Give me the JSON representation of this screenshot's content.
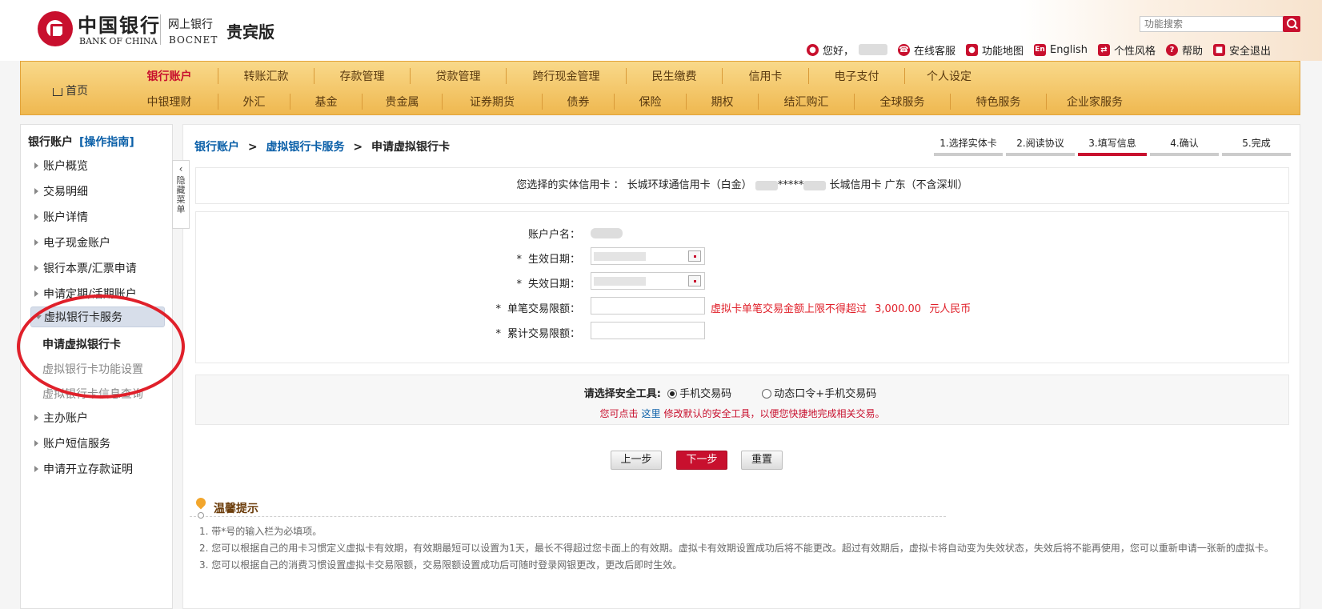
{
  "header": {
    "logo_cn": "中国银行",
    "logo_en": "BANK OF CHINA",
    "bank_cn": "网上银行",
    "bank_en": "BOCNET",
    "edition": "贵宾版",
    "search_placeholder": "功能搜索",
    "greeting": "您好，",
    "links": [
      "在线客服",
      "功能地图",
      "English",
      "个性风格",
      "帮助",
      "安全退出"
    ],
    "link_icons": [
      "user-icon",
      "headset-icon",
      "map-pin-icon",
      "en-icon",
      "swap-icon",
      "help-icon",
      "lock-icon"
    ]
  },
  "nav": {
    "home": "首页",
    "row1": [
      "银行账户",
      "转账汇款",
      "存款管理",
      "贷款管理",
      "跨行现金管理",
      "民生缴费",
      "信用卡",
      "电子支付",
      "个人设定"
    ],
    "row2": [
      "中银理财",
      "外汇",
      "基金",
      "贵金属",
      "证券期货",
      "债券",
      "保险",
      "期权",
      "结汇购汇",
      "全球服务",
      "特色服务",
      "企业家服务"
    ],
    "active": "银行账户"
  },
  "sidebar": {
    "title": "银行账户",
    "guide": "[操作指南]",
    "items": [
      "账户概览",
      "交易明细",
      "账户详情",
      "电子现金账户",
      "银行本票/汇票申请",
      "申请定期/活期账户",
      "虚拟银行卡服务"
    ],
    "subitems": [
      "申请虚拟银行卡",
      "虚拟银行卡功能设置",
      "虚拟银行卡信息查询"
    ],
    "items_after": [
      "主办账户",
      "账户短信服务",
      "申请开立存款证明"
    ],
    "collapse_label": [
      "隐",
      "藏",
      "菜",
      "单"
    ],
    "highlight_color": "#e0202a"
  },
  "main": {
    "breadcrumb": [
      "银行账户",
      "虚拟银行卡服务",
      "申请虚拟银行卡"
    ],
    "breadcrumb_sep": ">",
    "steps": [
      "1.选择实体卡",
      "2.阅读协议",
      "3.填写信息",
      "4.确认",
      "5.完成"
    ],
    "current_step": 3,
    "card_info_prefix": "您选择的实体信用卡 ： 长城环球通信用卡（白金）",
    "card_info_masked": "*****",
    "card_info_suffix": "长城信用卡 广东（不含深圳）",
    "form": {
      "account_name_label": "账户户名：",
      "start_date_label": "生效日期：",
      "end_date_label": "失效日期：",
      "single_limit_label": "单笔交易限额：",
      "total_limit_label": "累计交易限额：",
      "required_mark": "*",
      "single_limit_hint": "虚拟卡单笔交易金额上限不得超过",
      "single_limit_amount": "3,000.00",
      "single_limit_currency": "元人民币",
      "single_limit_value": "",
      "total_limit_value": ""
    },
    "security": {
      "title": "请选择安全工具:",
      "options": [
        "手机交易码",
        "动态口令+手机交易码"
      ],
      "selected": "手机交易码",
      "note_prefix": "您可点击",
      "note_link": "这里",
      "note_suffix": "修改默认的安全工具，以便您快捷地完成相关交易。"
    },
    "buttons": {
      "prev": "上一步",
      "next": "下一步",
      "reset": "重置"
    },
    "tips": {
      "title": "温馨提示",
      "lines": [
        "1. 带*号的输入栏为必填项。",
        "2. 您可以根据自己的用卡习惯定义虚拟卡有效期，有效期最短可以设置为1天，最长不得超过您卡面上的有效期。虚拟卡有效期设置成功后将不能更改。超过有效期后，虚拟卡将自动变为失效状态，失效后将不能再使用，您可以重新申请一张新的虚拟卡。",
        "3. 您可以根据自己的消费习惯设置虚拟卡交易限额，交易限额设置成功后可随时登录网银更改，更改后即时生效。"
      ]
    }
  },
  "colors": {
    "brand_red": "#c8102e",
    "nav_gold": "#efb850",
    "link_blue": "#0a5fa8"
  }
}
